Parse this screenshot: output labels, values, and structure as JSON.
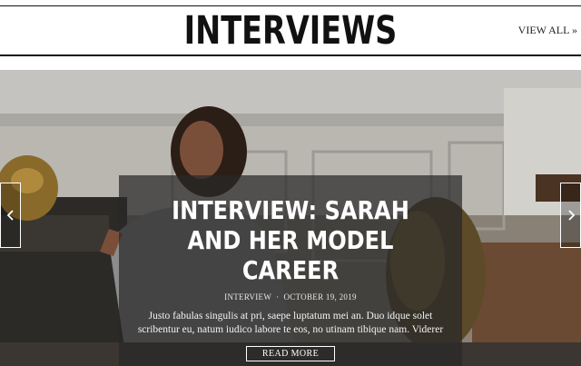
{
  "header": {
    "title": "INTERVIEWS",
    "view_all": "VIEW ALL »"
  },
  "slide": {
    "title": "INTERVIEW: SARAH AND HER MODEL CAREER",
    "category": "INTERVIEW",
    "separator": "·",
    "date": "OCTOBER 19, 2019",
    "excerpt": "Justo fabulas singulis at pri, saepe luptatum mei an. Duo idque solet scribentur eu, natum iudico labore te eos, no utinam tibique nam. Viderer",
    "button": "READ MORE"
  }
}
